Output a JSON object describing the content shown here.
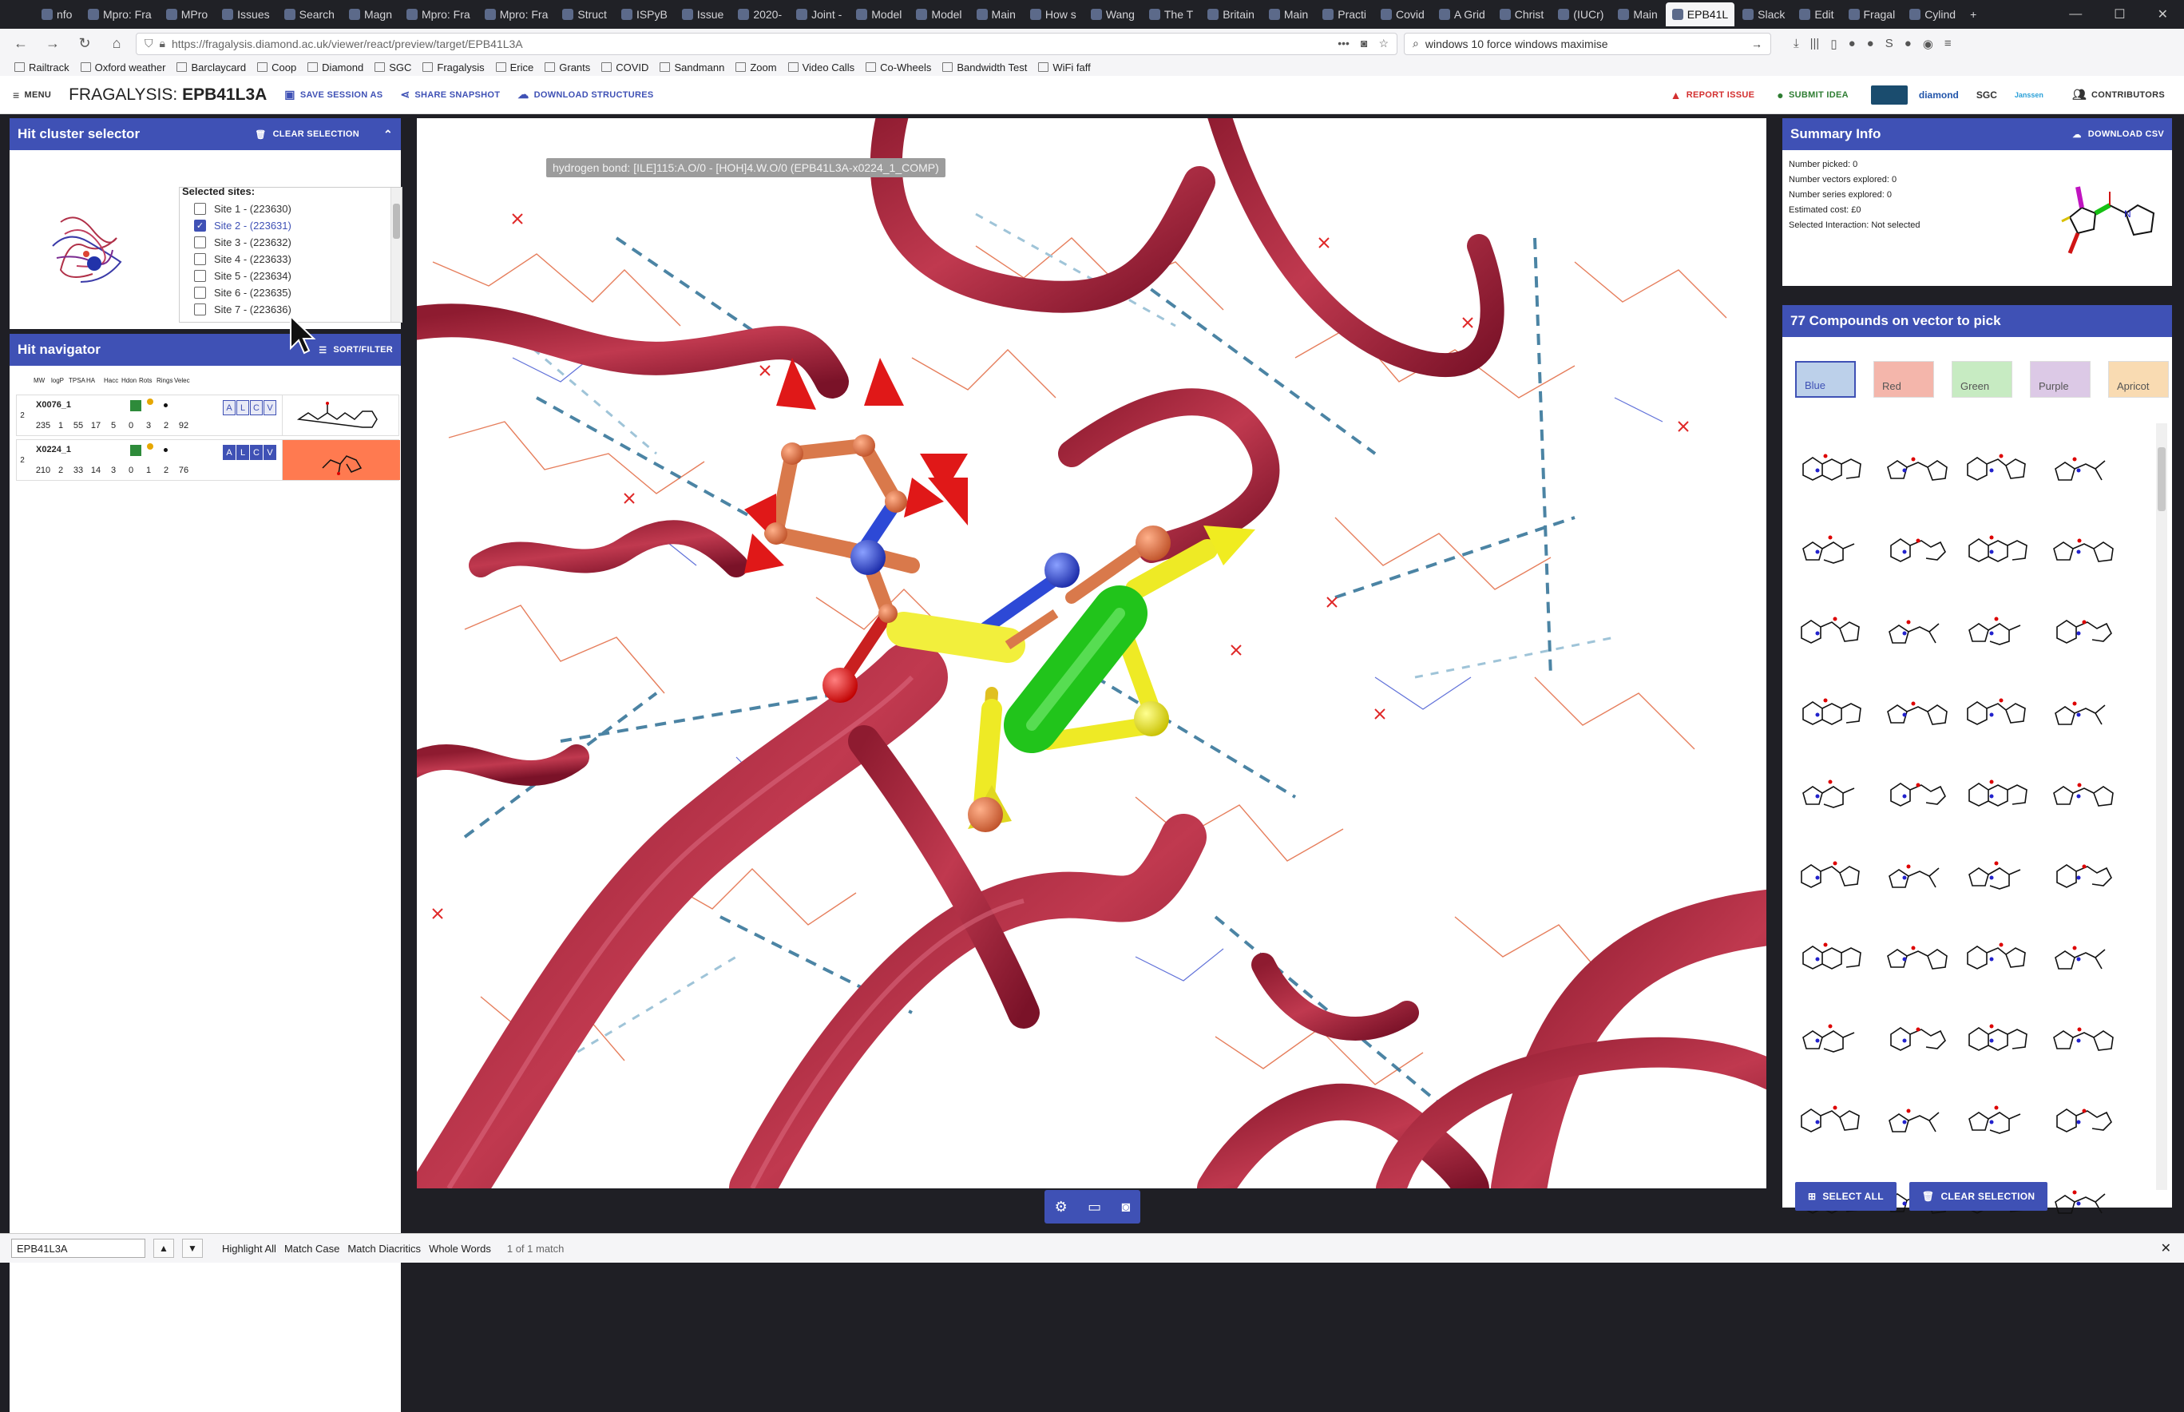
{
  "browser": {
    "tabs": [
      {
        "label": "nfo"
      },
      {
        "label": "Mpro: Fra"
      },
      {
        "label": "MPro"
      },
      {
        "label": "Issues"
      },
      {
        "label": "Search"
      },
      {
        "label": "Magn"
      },
      {
        "label": "Mpro: Fra"
      },
      {
        "label": "Mpro: Fra"
      },
      {
        "label": "Struct"
      },
      {
        "label": "ISPyB"
      },
      {
        "label": "Issue"
      },
      {
        "label": "2020-"
      },
      {
        "label": "Joint -"
      },
      {
        "label": "Model"
      },
      {
        "label": "Model"
      },
      {
        "label": "Main"
      },
      {
        "label": "How s"
      },
      {
        "label": "Wang"
      },
      {
        "label": "The T"
      },
      {
        "label": "Britain"
      },
      {
        "label": "Main"
      },
      {
        "label": "Practi"
      },
      {
        "label": "Covid"
      },
      {
        "label": "A Grid"
      },
      {
        "label": "Christ"
      },
      {
        "label": "(IUCr)"
      },
      {
        "label": "Main"
      },
      {
        "label": "EPB41L",
        "active": true
      },
      {
        "label": "Slack"
      },
      {
        "label": "Edit"
      },
      {
        "label": "Fragal"
      },
      {
        "label": "Cylind"
      }
    ],
    "url": "https://fragalysis.diamond.ac.uk/viewer/react/preview/target/EPB41L3A",
    "search": "windows 10 force windows maximise",
    "bookmarks": [
      "Railtrack",
      "Oxford weather",
      "Barclaycard",
      "Coop",
      "Diamond",
      "SGC",
      "Fragalysis",
      "Erice",
      "Grants",
      "COVID",
      "Sandmann",
      "Zoom",
      "Video Calls",
      "Co-Wheels",
      "Bandwidth Test",
      "WiFi faff"
    ]
  },
  "header": {
    "menu": "MENU",
    "title_prefix": "FRAGALYSIS:",
    "title_target": "EPB41L3A",
    "save_session": "SAVE SESSION AS",
    "share_snapshot": "SHARE SNAPSHOT",
    "download_structures": "DOWNLOAD STRUCTURES",
    "report_issue": "REPORT ISSUE",
    "submit_idea": "SUBMIT IDEA",
    "contributors": "CONTRIBUTORS",
    "logos": [
      "diamond",
      "SGC",
      "Janssen"
    ]
  },
  "hit_cluster": {
    "title": "Hit cluster selector",
    "clear": "CLEAR SELECTION",
    "selected_label": "Selected sites:",
    "sites": [
      {
        "label": "Site 1 - (223630)",
        "checked": false
      },
      {
        "label": "Site 2 - (223631)",
        "checked": true
      },
      {
        "label": "Site 3 - (223632)",
        "checked": false
      },
      {
        "label": "Site 4 - (223633)",
        "checked": false
      },
      {
        "label": "Site 5 - (223634)",
        "checked": false
      },
      {
        "label": "Site 6 - (223635)",
        "checked": false
      },
      {
        "label": "Site 7 - (223636)",
        "checked": false
      }
    ]
  },
  "hit_navigator": {
    "title": "Hit navigator",
    "sort": "SORT/FILTER",
    "columns": [
      "MW",
      "logP",
      "TPSA",
      "HA",
      "Hacc",
      "Hdon",
      "Rots",
      "Rings",
      "Velec"
    ],
    "compounds": [
      {
        "index": "2",
        "name": "X0076_1",
        "values": [
          "235",
          "1",
          "55",
          "17",
          "5",
          "0",
          "3",
          "2",
          "92"
        ]
      },
      {
        "index": "2",
        "name": "X0224_1",
        "values": [
          "210",
          "2",
          "33",
          "14",
          "3",
          "0",
          "1",
          "2",
          "76"
        ]
      }
    ],
    "alcv": [
      "A",
      "L",
      "C",
      "V"
    ]
  },
  "viewer": {
    "tooltip": "hydrogen bond: [ILE]115:A.O/0 - [HOH]4.W.O/0 (EPB41L3A-x0224_1_COMP)"
  },
  "summary": {
    "title": "Summary Info",
    "download": "DOWNLOAD CSV",
    "lines": [
      "Number picked: 0",
      "Number vectors explored: 0",
      "Number series explored: 0",
      "Estimated cost: £0",
      "Selected Interaction: Not selected"
    ]
  },
  "compounds_panel": {
    "title": "77 Compounds on vector to pick",
    "colors": [
      {
        "label": "Blue",
        "bg": "#bcd0ea",
        "border": "#3f51b5"
      },
      {
        "label": "Red",
        "bg": "#f4b6ab",
        "border": "#ddd"
      },
      {
        "label": "Green",
        "bg": "#c7ebc2",
        "border": "#ddd"
      },
      {
        "label": "Purple",
        "bg": "#dcc9e6",
        "border": "#ddd"
      },
      {
        "label": "Apricot",
        "bg": "#f9dbb2",
        "border": "#ddd"
      }
    ],
    "select_all": "SELECT ALL",
    "clear_selection": "CLEAR SELECTION"
  },
  "findbar": {
    "query": "EPB41L3A",
    "highlight_all": "Highlight All",
    "match_case": "Match Case",
    "match_diacritics": "Match Diacritics",
    "whole_words": "Whole Words",
    "result": "1 of 1 match"
  },
  "colors": {
    "accent": "#3f51b5",
    "ribbon": "#a8243a",
    "report": "#d32f2f",
    "idea": "#2e7d32"
  }
}
